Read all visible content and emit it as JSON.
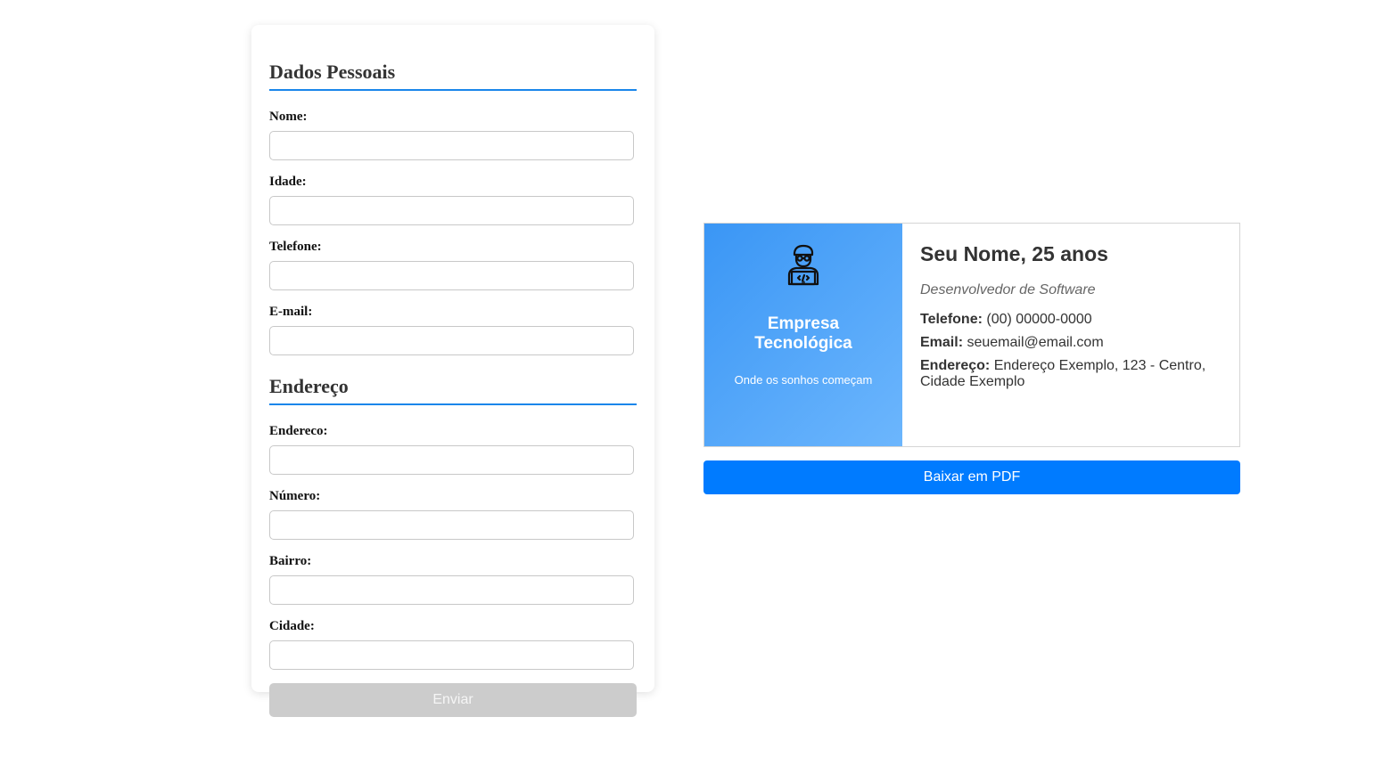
{
  "form": {
    "personal_title": "Dados Pessoais",
    "personal_fields": [
      {
        "label": "Nome:",
        "value": ""
      },
      {
        "label": "Idade:",
        "value": ""
      },
      {
        "label": "Telefone:",
        "value": ""
      },
      {
        "label": "E-mail:",
        "value": ""
      }
    ],
    "address_title": "Endereço",
    "address_fields": [
      {
        "label": "Endereco:",
        "value": ""
      },
      {
        "label": "Número:",
        "value": ""
      },
      {
        "label": "Bairro:",
        "value": ""
      },
      {
        "label": "Cidade:",
        "value": ""
      }
    ],
    "submit_label": "Enviar"
  },
  "card": {
    "icon": "developer-icon",
    "company": "Empresa Tecnológica",
    "slogan": "Onde os sonhos começam",
    "name_line": "Seu Nome, 25 anos",
    "job_title": "Desenvolvedor de Software",
    "phone_label": "Telefone:",
    "phone_value": "(00) 00000-0000",
    "email_label": "Email:",
    "email_value": "seuemail@email.com",
    "address_label": "Endereço:",
    "address_value": "Endereço Exemplo, 123 - Centro, Cidade Exemplo"
  },
  "pdf_button_label": "Baixar em PDF",
  "colors": {
    "accent": "#007bff",
    "section_underline": "#1a86ea",
    "card_gradient_start": "#3a96f5",
    "card_gradient_end": "#6cb6fd",
    "disabled_button": "#cccccc"
  }
}
